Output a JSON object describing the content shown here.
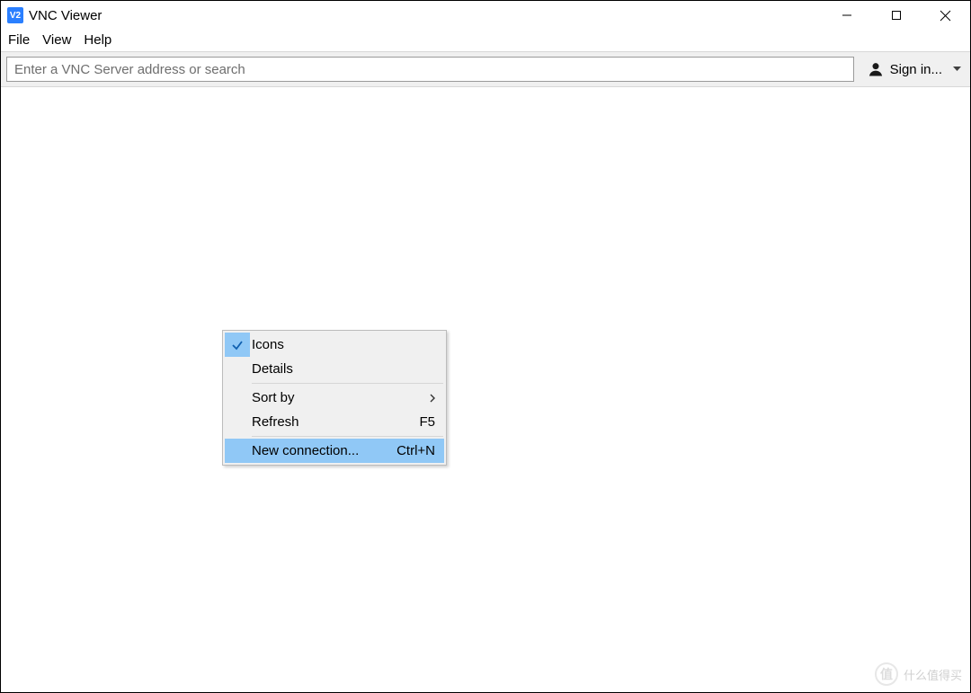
{
  "window": {
    "title": "VNC Viewer",
    "app_icon_text": "V2"
  },
  "menubar": {
    "items": [
      "File",
      "View",
      "Help"
    ]
  },
  "toolbar": {
    "search_placeholder": "Enter a VNC Server address or search",
    "signin_label": "Sign in..."
  },
  "context_menu": {
    "items": [
      {
        "label": "Icons",
        "checked": true,
        "submenu": false,
        "shortcut": ""
      },
      {
        "label": "Details",
        "checked": false,
        "submenu": false,
        "shortcut": ""
      },
      {
        "label": "Sort by",
        "checked": false,
        "submenu": true,
        "shortcut": ""
      },
      {
        "label": "Refresh",
        "checked": false,
        "submenu": false,
        "shortcut": "F5"
      },
      {
        "label": "New connection...",
        "checked": false,
        "submenu": false,
        "shortcut": "Ctrl+N",
        "highlight": true
      }
    ],
    "separators_after": [
      1,
      3
    ]
  },
  "watermark": {
    "logo_text": "值",
    "text": "什么值得买"
  }
}
